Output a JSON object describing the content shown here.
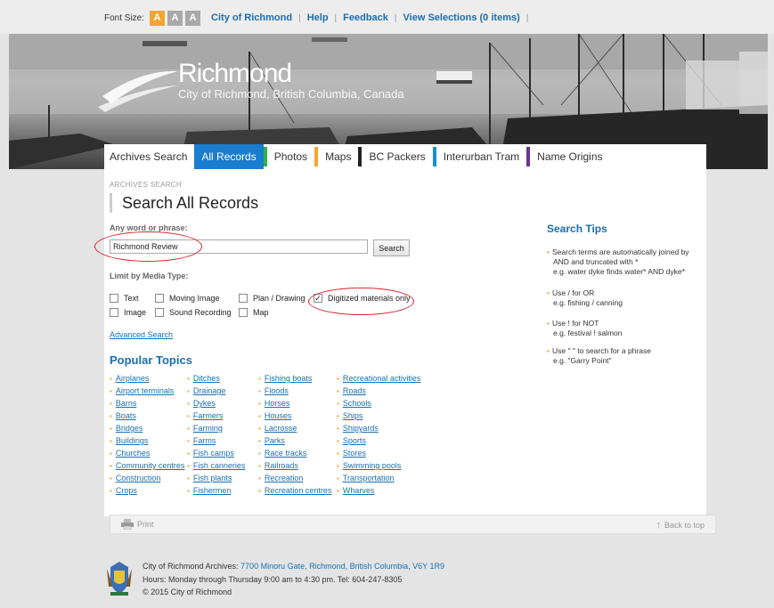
{
  "topbar": {
    "font_size_label": "Font Size",
    "font_buttons": [
      "A",
      "A",
      "A"
    ],
    "links": [
      "City of Richmond",
      "Help",
      "Feedback",
      "View Selections (0 items)"
    ]
  },
  "banner": {
    "logo_name": "Richmond",
    "logo_sub": "City of Richmond, British Columbia, Canada"
  },
  "nav": {
    "tabs": [
      {
        "label": "Archives Search",
        "color": "#ffffff"
      },
      {
        "label": "All Records",
        "color": "#1a7dd0"
      },
      {
        "label": "Photos",
        "color": "#2bb24c"
      },
      {
        "label": "Maps",
        "color": "#f2a634"
      },
      {
        "label": "BC Packers",
        "color": "#222222"
      },
      {
        "label": "Interurban Tram",
        "color": "#1a8fd0"
      },
      {
        "label": "Name Origins",
        "color": "#6d3395"
      }
    ]
  },
  "main": {
    "breadcrumb": "ARCHIVES SEARCH",
    "title": "Search All Records",
    "any_word_label": "Any word or phrase:",
    "search_value": "Richmond Review",
    "search_button": "Search",
    "media_type_label": "Limit by Media Type:",
    "media_types": {
      "text": "Text",
      "moving_image": "Moving Image",
      "plan_drawing": "Plan / Drawing",
      "digitized": "Digitized materials only",
      "image": "Image",
      "sound_recording": "Sound Recording",
      "map": "Map"
    },
    "digitized_checked": true,
    "advanced_search": "Advanced Search",
    "popular_topics_title": "Popular Topics",
    "topics_col1": [
      "Airplanes",
      "Airport terminals",
      "Barns",
      "Boats",
      "Bridges",
      "Buildings",
      "Churches",
      "Community centres",
      "Construction",
      "Crops"
    ],
    "topics_col2": [
      "Ditches",
      "Drainage",
      "Dykes",
      "Farmers",
      "Farming",
      "Farms",
      "Fish camps",
      "Fish canneries",
      "Fish plants",
      "Fishermen"
    ],
    "topics_col3": [
      "Fishing boats",
      "Floods",
      "Horses",
      "Houses",
      "Lacrosse",
      "Parks",
      "Race tracks",
      "Railroads",
      "Recreation",
      "Recreation centres"
    ],
    "topics_col4": [
      "Recreational activities",
      "Roads",
      "Schools",
      "Ships",
      "Shipyards",
      "Sports",
      "Stores",
      "Swimming pools",
      "Transportation",
      "Wharves"
    ],
    "search_tips_title": "Search Tips",
    "tips": {
      "t1a": "Search terms are automatically joined by",
      "t1b": "AND and truncated with *",
      "t1c": "e.g. water dyke finds water* AND dyke*",
      "t2a": "Use / for OR",
      "t2b": "e.g. fishing / canning",
      "t3a": "Use ! for NOT",
      "t3b": "e.g. festival ! salmon",
      "t4a": "Use \" \" to search for a phrase",
      "t4b": "e.g. \"Garry Point\""
    },
    "print": "Print",
    "back_to_top": "Back to top"
  },
  "footer": {
    "line1_prefix": "City of Richmond Archives: ",
    "line1_address": "7700 Minoru Gate, Richmond, British Columbia, V6Y 1R9",
    "line2": "Hours: Monday through Thursday 9:00 am to 4:30 pm. Tel: 604-247-8305",
    "line3": "© 2015 City of Richmond"
  }
}
